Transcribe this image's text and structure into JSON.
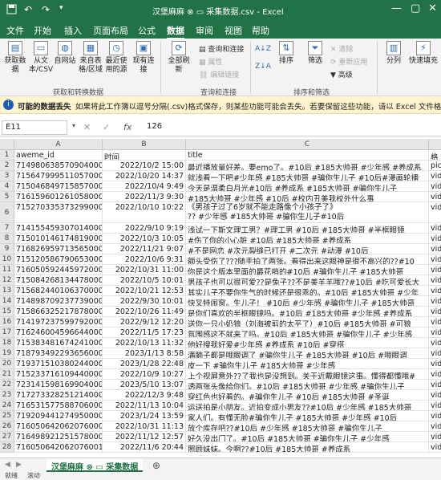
{
  "titlebar": {
    "title": "汉堡麻麻 ⊗ ▭  采集数据.csv  -  Excel",
    "save_icon": "save-icon",
    "undo_icon": "undo-icon",
    "redo_icon": "redo-icon"
  },
  "menu": {
    "items": [
      "文件",
      "开始",
      "插入",
      "页面布局",
      "公式",
      "数据",
      "审阅",
      "视图",
      "帮助"
    ],
    "active": "数据"
  },
  "ribbon": {
    "get_data": "获取数据",
    "from_text": "从文本/CSV",
    "from_web": "自网站",
    "from_table": "来自表格/区域",
    "recent": "最近使用的源",
    "existing": "现有连接",
    "refresh_all": "全部刷新",
    "queries_conn": "查询和连接",
    "properties": "属性",
    "edit_links": "编辑链接",
    "sort": "排序",
    "filter": "筛选",
    "clear": "清除",
    "reapply": "重新应用",
    "advanced": "高级",
    "split": "分列",
    "flash_fill": "快速填充",
    "group_get": "获取和转换数据",
    "group_queries": "查询和连接",
    "group_sort": "排序和筛选"
  },
  "infobar": {
    "bold": "可能的数据丢失",
    "message": "如果将此工作簿以逗号分隔(.csv)格式保存，则某些功能可能会丢失。若要保留这些功能，请以 Excel 文件格式保存。"
  },
  "formula_bar": {
    "name_box": "E11",
    "cancel": "✕",
    "enter": "✓",
    "fx": "fx",
    "value": "126"
  },
  "sheet": {
    "columns": [
      "A",
      "B",
      "C"
    ],
    "row_numbers": [
      "1",
      "2",
      "3",
      "4",
      "5",
      "6",
      "7",
      "8",
      "9",
      "10",
      "11",
      "12",
      "13",
      "14",
      "15",
      "16",
      "17",
      "18",
      "19",
      "20",
      "21",
      "22",
      "23",
      "24",
      "25",
      "26",
      "27",
      "28",
      "29",
      "30",
      "31",
      "32",
      "33",
      "34"
    ],
    "rows": [
      [
        "aweme_id",
        "时间",
        "title",
        "格"
      ],
      [
        "714980638570904000",
        "2022/10/2 15:00",
        "最近播放量好差。要emo了。#10后 #185大帅哥 #少年感 #养成系",
        "pic"
      ],
      [
        "715647999511057000",
        "2022/10/20 14:37",
        "就浅看一下吧#少年感 #185大帅哥 #骗你生儿子 #10后#漫画轮播",
        "vid"
      ],
      [
        "715046849715857000",
        "2022/10/4 9:49",
        "今天是温柔白月光#10后 #养成系 #185大帅哥 #骗你生儿子",
        "vid"
      ],
      [
        "716159601261058000",
        "2022/11/3 9:30",
        "#185大帅哥 #少年感 #10后 #校内丑美我校外什么事",
        "vid"
      ],
      [
        "715270335373299000",
        "2022/10/10 10:22",
        "《男孩子过了6岁就不能走路像个小孩子了》\n?? #少年感 #185大帅哥 #骗你生儿子#10后",
        "vid"
      ],
      [
        "714155459307014000",
        "2022/9/10 9:19",
        "浅试一下斯文理工男？#理工男 #10后 #185大帅哥 #半框眼镜",
        "vid"
      ],
      [
        "715010146174819000",
        "2022/10/3 10:05",
        "#伤了你的小心脏 #10后 #185大帅哥 #养成系",
        "vid"
      ],
      [
        "716826959713565000",
        "2022/11/21 9:07",
        "#不是网恋 #次元裂缝已打开 #二次元 #动漫 #10后",
        "vid"
      ],
      [
        "715120586790653000",
        "2022/10/6 9:31",
        "额头受伤了???随手拍了两张。看得出来这眼神是很不高兴的??#10",
        "vid"
      ],
      [
        "716050592445972000",
        "2022/10/31 11:00",
        "你是这个版本里面的最花哨的#10后 #骗你生儿子 #185大帅哥",
        "vid"
      ],
      [
        "715084268134478000",
        "2022/10/5 10:01",
        "男孩子也可以很可爱??是兔子??不是美羊羊哦??#10后 #吃可爱长大",
        "vid"
      ],
      [
        "715682440106370000",
        "2022/10/21 12:53",
        "其实儿子不要你生气的时候还是很乖的。#10后 #185大帅哥 #少年",
        "vid"
      ],
      [
        "714898709237739000",
        "2022/9/30 10:01",
        "快叉特闹窗。生儿子！ #10后 #少年感 #骗你生儿子 #185大帅哥",
        "vid"
      ],
      [
        "715866325217878000",
        "2022/10/26 11:49",
        "是你们喜欢的半框眼镜吗。#10后 #185大帅哥 #少年感 #养成系",
        "vid"
      ],
      [
        "714197237599792000",
        "2022/9/12 12:20",
        "送你一只小奶狼（刘海被剪的太平了）#10后 #185大帅哥 #可狼",
        "vid"
      ],
      [
        "716246004596644000",
        "2022/11/5 17:23",
        "氛围感这不就来了吗。#10后 #185大帅哥 #骗你生儿子 #少年感",
        "vid"
      ],
      [
        "715383481674241000",
        "2022/10/13 11:32",
        "他好搜我好爱#少年感 #养成系 #10后 #穿搭",
        "vid"
      ],
      [
        "718793492293656000",
        "2023/1/13 8:58",
        "满腩子都是哦眼调了 #骗你生儿子 #185大帅哥 #10后 #哦眼调",
        "vid"
      ],
      [
        "719371510380244000",
        "2023/1/28 22:48",
        "皮一下 #骗你生儿子 #185大帅哥 #少年感",
        "vid"
      ],
      [
        "715233716109440000",
        "2022/10/9 10:27",
        "上个视屏意外??了我也是没想到。关于近戴眼镜这事。懂得都懂哦#",
        "vid"
      ],
      [
        "723141598169904000",
        "2023/5/10 13:07",
        "透两张头像给你们。#10后 #185大帅哥 #少年感 #骗你生儿子",
        "vid"
      ],
      [
        "717273328251214000",
        "2022/12/3 9:48",
        "穿红色也好看的。#骗你生儿子 #10后 #185大帅哥 #圣诞",
        "vid"
      ],
      [
        "716531577588706000",
        "2022/11/13 10:04",
        "运送拍是小朋友。近拍变成小男友??#10后 #少年感 #185大帅哥",
        "vid"
      ],
      [
        "719209441274950000",
        "2023/1/24 13:59",
        "家人们。有懂无脸#骗你生儿子 #185大帅哥 #少年感 #10后",
        "vid"
      ],
      [
        "716050642062076000",
        "2022/10/31 11:13",
        "放个库存吧??#10后 #少年感 #185大帅哥 #骗你生儿子",
        "vid"
      ],
      [
        "716498921251578000",
        "2022/11/12 12:57",
        "好久没出门了。#10后 #185大帅哥 #骗你生儿子 #少年感",
        "vid"
      ],
      [
        "716050642062076001",
        "2022/11/6 20:44",
        "照顾妹妹。今啊??#10后 #185大帅哥 #养成系",
        "vid"
      ]
    ]
  },
  "tabs": {
    "sheets": [
      "汉堡麻麻 ⊗ ▭  采集数据"
    ],
    "add": "⊕"
  },
  "status": {
    "ready": "就绪",
    "mode": "滚动"
  }
}
